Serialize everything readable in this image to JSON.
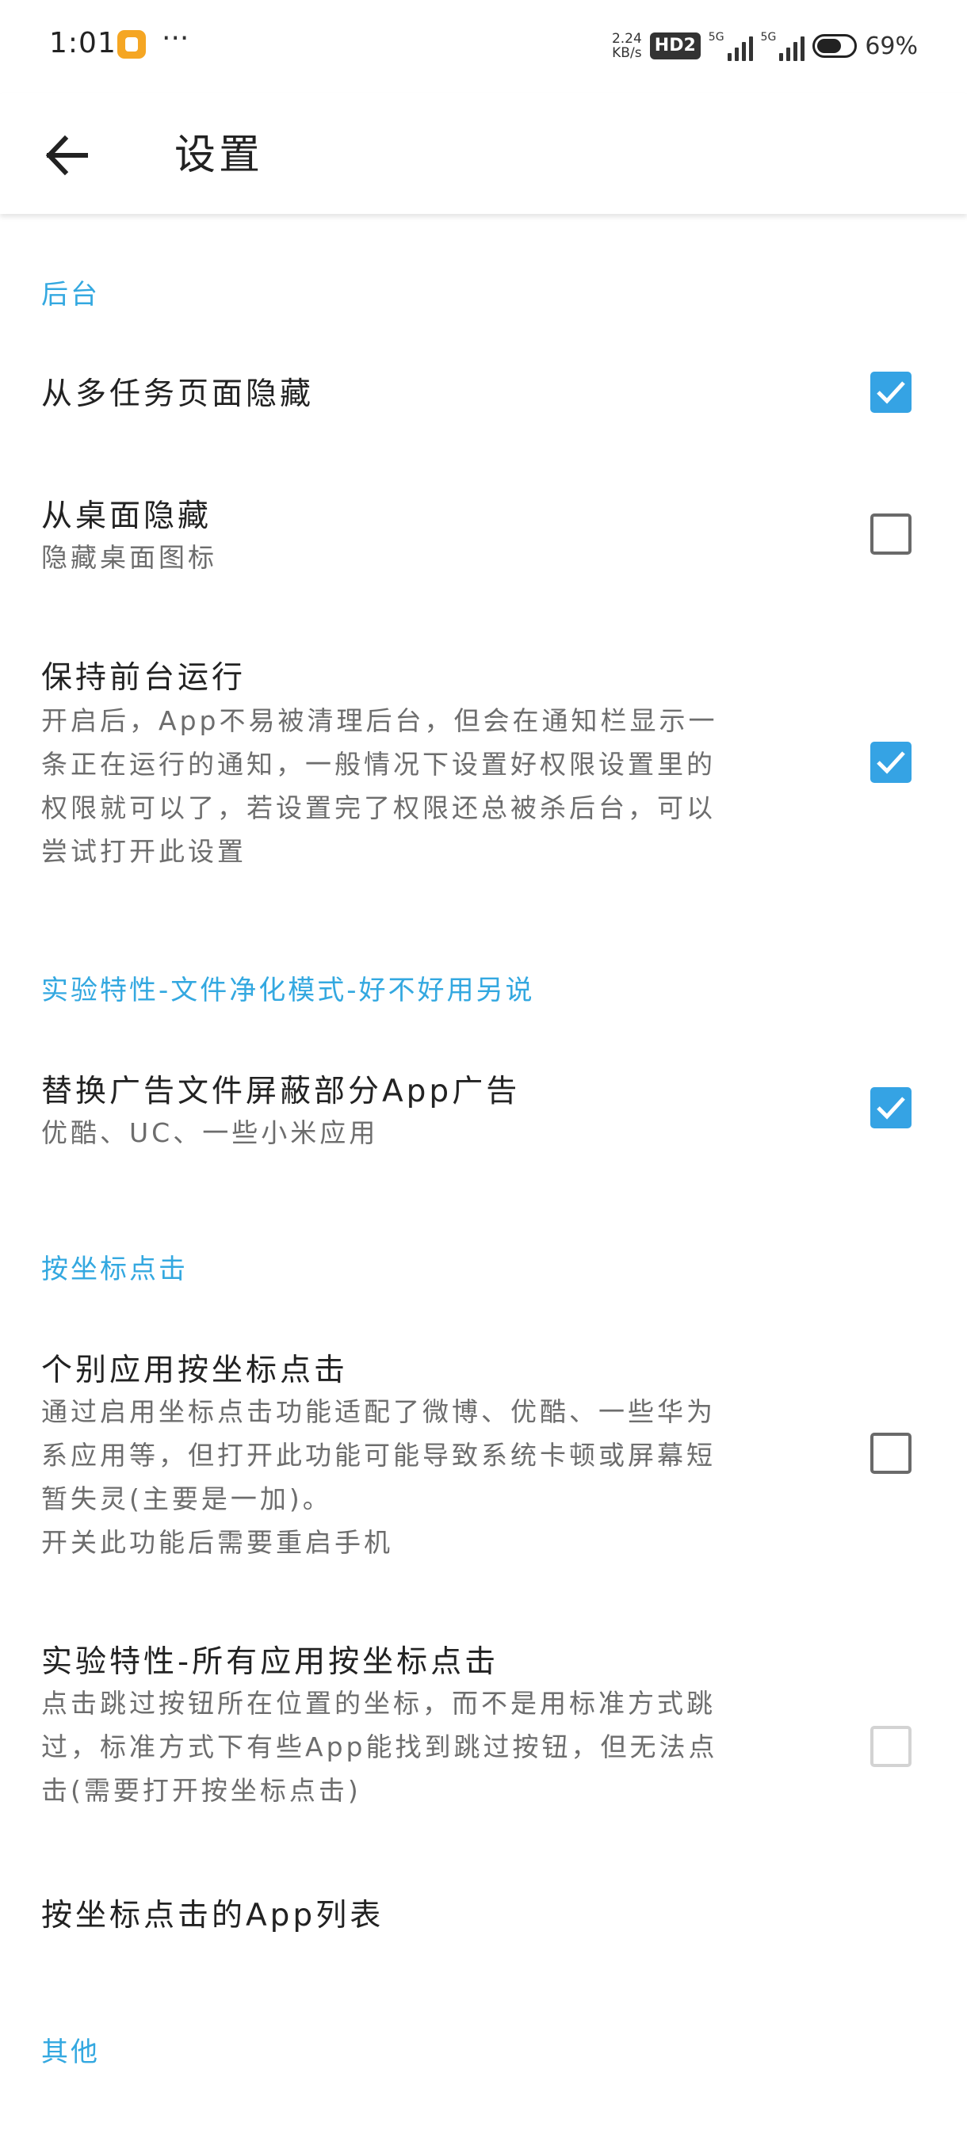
{
  "status_bar": {
    "time": "1:01",
    "more_dots": "···",
    "net_speed_top": "2.24",
    "net_speed_bottom": "KB/s",
    "hd_badge": "HD2",
    "signal1_tag": "5G",
    "signal2_tag": "5G",
    "battery_percent": "69%"
  },
  "app_bar": {
    "title": "设置",
    "back_icon": "arrow-left-icon"
  },
  "sections": [
    {
      "header": "后台",
      "items": [
        {
          "title": "从多任务页面隐藏",
          "summary": "",
          "checked": true,
          "enabled": true
        },
        {
          "title": "从桌面隐藏",
          "summary": "隐藏桌面图标",
          "checked": false,
          "enabled": true
        },
        {
          "title": "保持前台运行",
          "summary": "开启后，App不易被清理后台，但会在通知栏显示一\n条正在运行的通知，一般情况下设置好权限设置里的\n权限就可以了，若设置完了权限还总被杀后台，可以\n尝试打开此设置",
          "checked": true,
          "enabled": true
        }
      ]
    },
    {
      "header": "实验特性-文件净化模式-好不好用另说",
      "items": [
        {
          "title": "替换广告文件屏蔽部分App广告",
          "summary": "优酷、UC、一些小米应用",
          "checked": true,
          "enabled": true
        }
      ]
    },
    {
      "header": "按坐标点击",
      "items": [
        {
          "title": "个别应用按坐标点击",
          "summary": "通过启用坐标点击功能适配了微博、优酷、一些华为\n系应用等，但打开此功能可能导致系统卡顿或屏幕短\n暂失灵(主要是一加)。\n开关此功能后需要重启手机",
          "checked": false,
          "enabled": true
        },
        {
          "title": "实验特性-所有应用按坐标点击",
          "summary": "点击跳过按钮所在位置的坐标，而不是用标准方式跳\n过，标准方式下有些App能找到跳过按钮，但无法点\n击(需要打开按坐标点击)",
          "checked": false,
          "enabled": false
        },
        {
          "title": "按坐标点击的App列表"
        }
      ]
    },
    {
      "header": "其他"
    }
  ],
  "colors": {
    "accent": "#35a3e4",
    "section_header": "#33a8e0",
    "summary_text": "#6d6d6d"
  }
}
